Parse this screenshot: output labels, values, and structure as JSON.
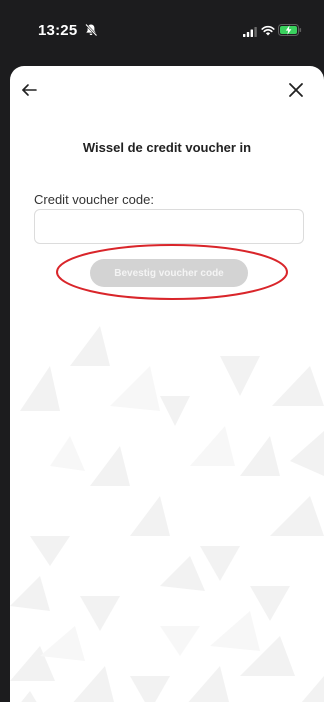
{
  "status_bar": {
    "time": "13:25",
    "bell_icon": "bell-slash-icon",
    "signal_icon": "cellular-signal-icon",
    "wifi_icon": "wifi-icon",
    "battery_icon": "battery-charging-icon",
    "battery_color": "#3ad15e"
  },
  "header": {
    "back_icon": "arrow-left-icon",
    "close_icon": "close-icon"
  },
  "main": {
    "title": "Wissel de credit voucher in",
    "field_label": "Credit voucher code:",
    "input_value": "",
    "input_placeholder": "",
    "confirm_label": "Bevestig voucher code",
    "confirm_state": "disabled"
  },
  "annotation": {
    "color": "#d9252a",
    "shape": "ellipse around confirm button"
  }
}
